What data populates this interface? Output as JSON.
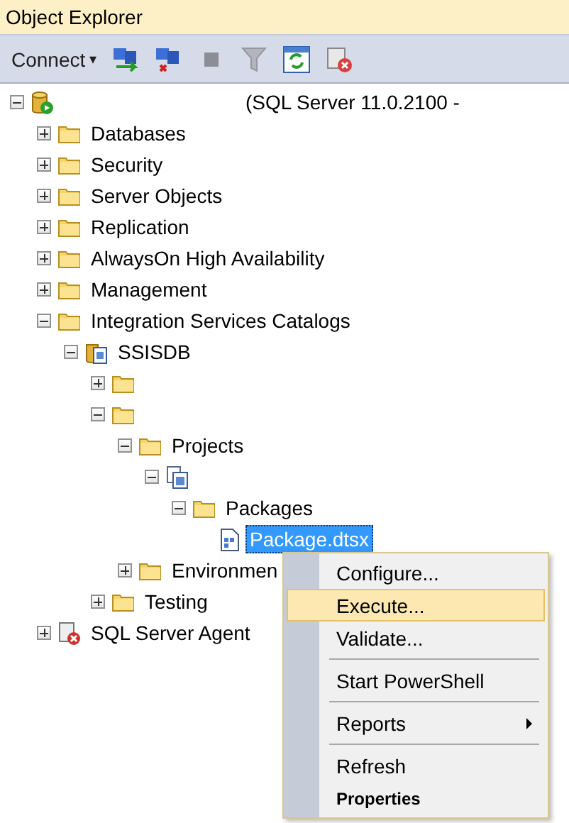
{
  "panel": {
    "title": "Object Explorer"
  },
  "toolbar": {
    "connect": {
      "label": "Connect",
      "caret": "▾"
    },
    "buttons": [
      {
        "kind": "connect",
        "disabled": false
      },
      {
        "kind": "disconnect",
        "disabled": false
      },
      {
        "kind": "stop",
        "disabled": true
      },
      {
        "kind": "filter",
        "disabled": true
      },
      {
        "kind": "refresh",
        "disabled": false
      },
      {
        "kind": "policy",
        "disabled": false
      }
    ]
  },
  "tree": [
    {
      "label": "(SQL Server 11.0.2100 -",
      "kind": "server",
      "expanded": true,
      "selected": false,
      "children": [
        {
          "label": "Databases",
          "kind": "folder",
          "expanded": false,
          "selected": false
        },
        {
          "label": "Security",
          "kind": "folder",
          "expanded": false,
          "selected": false
        },
        {
          "label": "Server Objects",
          "kind": "folder",
          "expanded": false,
          "selected": false
        },
        {
          "label": "Replication",
          "kind": "folder",
          "expanded": false,
          "selected": false
        },
        {
          "label": "AlwaysOn High Availability",
          "kind": "folder",
          "expanded": false,
          "selected": false
        },
        {
          "label": "Management",
          "kind": "folder",
          "expanded": false,
          "selected": false
        },
        {
          "label": "Integration Services Catalogs",
          "kind": "folder",
          "expanded": true,
          "selected": false,
          "children": [
            {
              "label": "SSISDB",
              "kind": "catalog",
              "expanded": true,
              "selected": false,
              "children": [
                {
                  "kind": "folder",
                  "expanded": false
                },
                {
                  "kind": "folder",
                  "expanded": true,
                  "children": [
                    {
                      "label": "Projects",
                      "kind": "folder",
                      "expanded": true,
                      "selected": false,
                      "children": [
                        {
                          "kind": "project",
                          "expanded": true,
                          "children": [
                            {
                              "label": "Packages",
                              "kind": "folder",
                              "expanded": true,
                              "selected": false,
                              "children": [
                                {
                                  "label": "Package.dtsx",
                                  "kind": "package",
                                  "selected": true
                                }
                              ]
                            }
                          ]
                        }
                      ]
                    },
                    {
                      "label": "Environmen",
                      "kind": "folder",
                      "expanded": false,
                      "selected": false
                    }
                  ]
                },
                {
                  "label": "Testing",
                  "kind": "folder",
                  "expanded": false,
                  "selected": false
                }
              ]
            }
          ]
        },
        {
          "label": "SQL Server Agent",
          "kind": "agent",
          "expanded": false,
          "selected": false
        }
      ]
    }
  ],
  "context_menu": [
    {
      "kind": "item",
      "label": "Configure...",
      "selected": false
    },
    {
      "kind": "item",
      "label": "Execute...",
      "selected": true
    },
    {
      "kind": "item",
      "label": "Validate...",
      "selected": false
    },
    {
      "kind": "separator"
    },
    {
      "kind": "item",
      "label": "Start PowerShell",
      "selected": false
    },
    {
      "kind": "separator"
    },
    {
      "kind": "item",
      "label": "Reports",
      "selected": false,
      "submenu": true
    },
    {
      "kind": "separator"
    },
    {
      "kind": "item",
      "label": "Refresh",
      "selected": false
    },
    {
      "kind": "item",
      "label": "Properties",
      "selected": false,
      "default": true
    }
  ]
}
